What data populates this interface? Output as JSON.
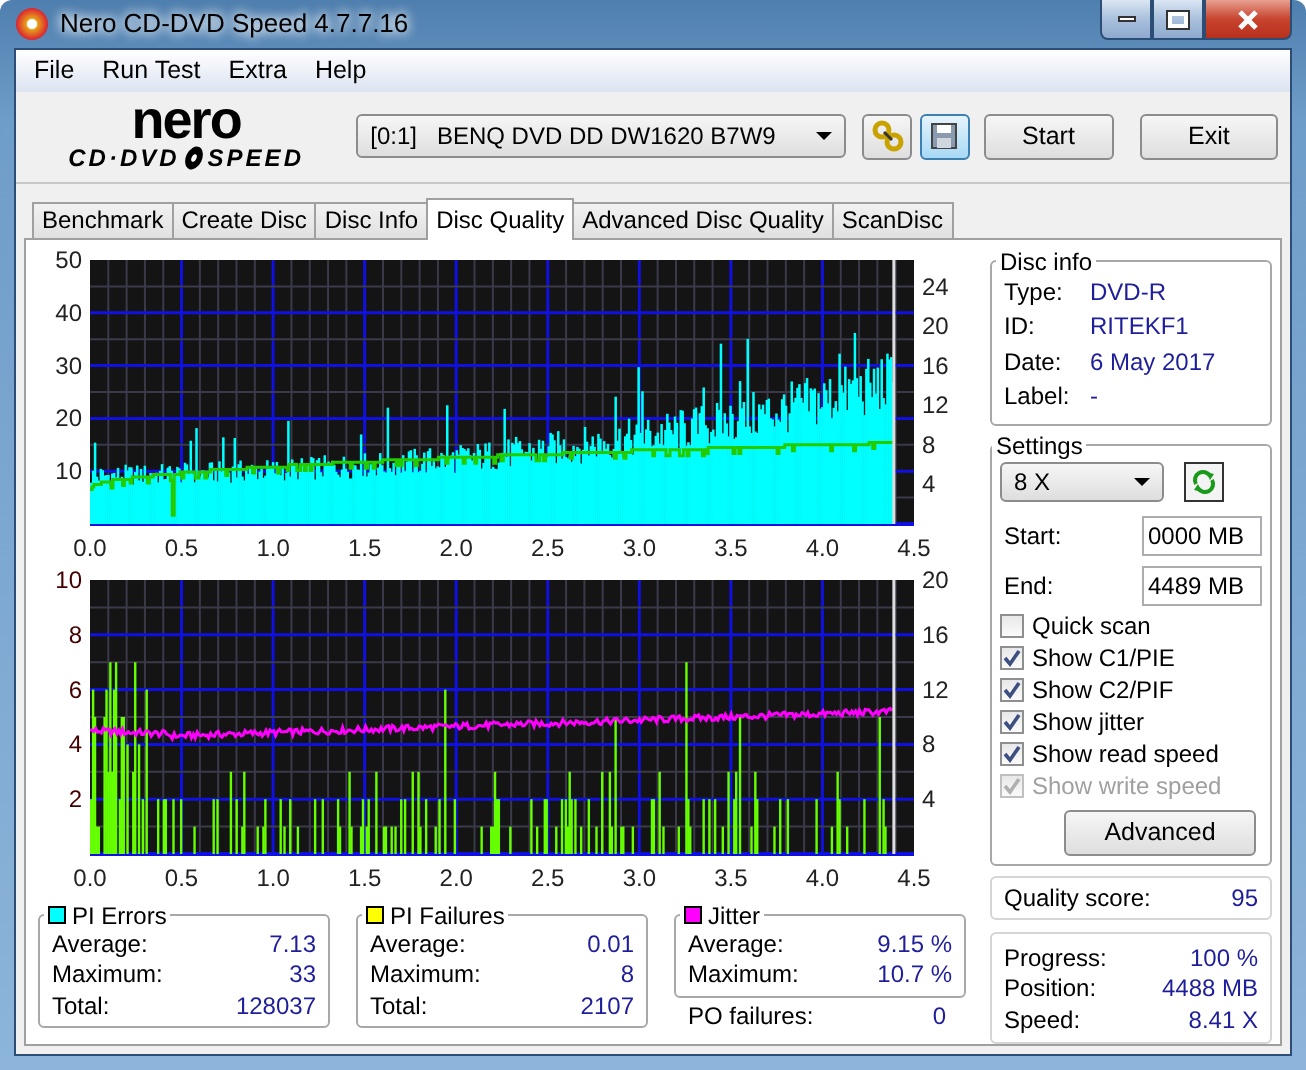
{
  "window": {
    "title": "Nero CD-DVD Speed 4.7.7.16"
  },
  "menu": [
    "File",
    "Run Test",
    "Extra",
    "Help"
  ],
  "logo": {
    "brand": "nero",
    "product_left": "CD·DVD",
    "product_right": "SPEED"
  },
  "toolbar": {
    "drive": "[0:1]   BENQ DVD DD DW1620 B7W9",
    "buttons": [
      "Start",
      "Exit"
    ]
  },
  "tabs": [
    {
      "label": "Benchmark",
      "selected": false
    },
    {
      "label": "Create Disc",
      "selected": false
    },
    {
      "label": "Disc Info",
      "selected": false
    },
    {
      "label": "Disc Quality",
      "selected": true
    },
    {
      "label": "Advanced Disc Quality",
      "selected": false
    },
    {
      "label": "ScanDisc",
      "selected": false
    }
  ],
  "charts": [
    {
      "y_left_ticks": [
        "50",
        "40",
        "30",
        "20",
        "10"
      ],
      "y_right_ticks": [
        "24",
        "20",
        "16",
        "12",
        "8",
        "4"
      ],
      "x_ticks": [
        "0.0",
        "0.5",
        "1.0",
        "1.5",
        "2.0",
        "2.5",
        "3.0",
        "3.5",
        "4.0",
        "4.5"
      ]
    },
    {
      "y_left_ticks": [
        "10",
        "8",
        "6",
        "4",
        "2"
      ],
      "y_right_ticks": [
        "20",
        "16",
        "12",
        "8",
        "4"
      ],
      "x_ticks": [
        "0.0",
        "0.5",
        "1.0",
        "1.5",
        "2.0",
        "2.5",
        "3.0",
        "3.5",
        "4.0",
        "4.5"
      ]
    }
  ],
  "stats": [
    {
      "title": "PI Errors",
      "color": "#00ffff",
      "rows": [
        {
          "label": "Average:",
          "value": "7.13"
        },
        {
          "label": "Maximum:",
          "value": "33"
        },
        {
          "label": "Total:",
          "value": "128037"
        }
      ]
    },
    {
      "title": "PI Failures",
      "color": "#ffff00",
      "rows": [
        {
          "label": "Average:",
          "value": "0.01"
        },
        {
          "label": "Maximum:",
          "value": "8"
        },
        {
          "label": "Total:",
          "value": "2107"
        }
      ]
    },
    {
      "title": "Jitter",
      "color": "#ff00ff",
      "rows": [
        {
          "label": "Average:",
          "value": "9.15 %"
        },
        {
          "label": "Maximum:",
          "value": "10.7 %"
        }
      ]
    }
  ],
  "po_failures": {
    "label": "PO failures:",
    "value": "0"
  },
  "disc_info": {
    "title": "Disc info",
    "rows": [
      {
        "label": "Type:",
        "value": "DVD-R"
      },
      {
        "label": "ID:",
        "value": "RITEKF1"
      },
      {
        "label": "Date:",
        "value": "6 May 2017"
      },
      {
        "label": "Label:",
        "value": "-"
      }
    ]
  },
  "settings": {
    "title": "Settings",
    "speed": "8 X",
    "start": {
      "label": "Start:",
      "value": "0000 MB"
    },
    "end": {
      "label": "End:",
      "value": "4489 MB"
    },
    "options": [
      {
        "label": "Quick scan",
        "checked": false,
        "disabled": false
      },
      {
        "label": "Show C1/PIE",
        "checked": true,
        "disabled": false
      },
      {
        "label": "Show C2/PIF",
        "checked": true,
        "disabled": false
      },
      {
        "label": "Show jitter",
        "checked": true,
        "disabled": false
      },
      {
        "label": "Show read speed",
        "checked": true,
        "disabled": false
      },
      {
        "label": "Show write speed",
        "checked": true,
        "disabled": true
      }
    ],
    "button": "Advanced"
  },
  "quality": {
    "label": "Quality score:",
    "value": "95"
  },
  "progress": [
    {
      "label": "Progress:",
      "value": "100 %"
    },
    {
      "label": "Position:",
      "value": "4488 MB"
    },
    {
      "label": "Speed:",
      "value": "8.41 X"
    }
  ]
}
